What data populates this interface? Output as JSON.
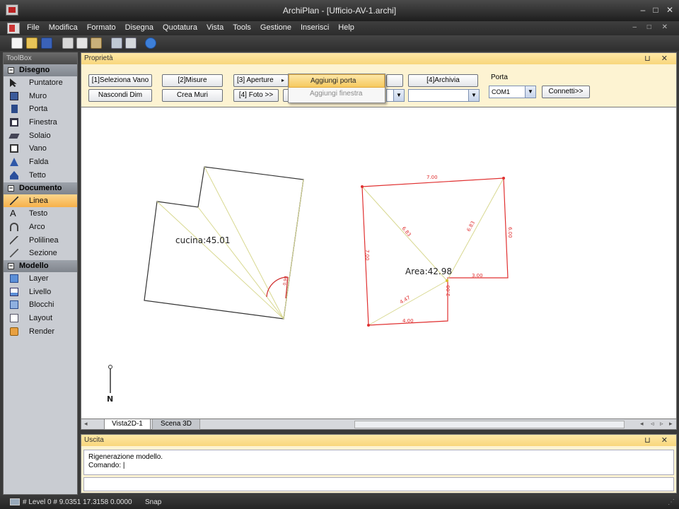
{
  "window": {
    "title": "ArchiPlan - [Ufficio-AV-1.archi]",
    "minimize": "–",
    "maximize": "□",
    "close": "✕"
  },
  "menu": {
    "items": [
      "File",
      "Modifica",
      "Formato",
      "Disegna",
      "Quotatura",
      "Vista",
      "Tools",
      "Gestione",
      "Inserisci",
      "Help"
    ],
    "mdi_controls": "– □ ✕"
  },
  "toolbox": {
    "title": "ToolBox",
    "sections": [
      {
        "label": "Disegno",
        "items": [
          {
            "label": "Puntatore",
            "icon": "pointer-icon"
          },
          {
            "label": "Muro",
            "icon": "wall-icon"
          },
          {
            "label": "Porta",
            "icon": "door-icon"
          },
          {
            "label": "Finestra",
            "icon": "window-icon"
          },
          {
            "label": "Solaio",
            "icon": "floor-slab-icon"
          },
          {
            "label": "Vano",
            "icon": "room-icon"
          },
          {
            "label": "Falda",
            "icon": "roof-pitch-icon"
          },
          {
            "label": "Tetto",
            "icon": "roof-icon"
          }
        ]
      },
      {
        "label": "Documento",
        "items": [
          {
            "label": "Linea",
            "icon": "line-icon",
            "selected": true
          },
          {
            "label": "Testo",
            "icon": "text-icon"
          },
          {
            "label": "Arco",
            "icon": "arc-icon"
          },
          {
            "label": "Polilinea",
            "icon": "polyline-icon"
          },
          {
            "label": "Sezione",
            "icon": "section-icon"
          }
        ]
      },
      {
        "label": "Modello",
        "items": [
          {
            "label": "Layer",
            "icon": "layer-icon"
          },
          {
            "label": "Livello",
            "icon": "level-icon"
          },
          {
            "label": "Blocchi",
            "icon": "blocks-icon"
          },
          {
            "label": "Layout",
            "icon": "layout-icon"
          },
          {
            "label": "Render",
            "icon": "render-icon"
          }
        ]
      }
    ]
  },
  "properties": {
    "title": "Proprietà",
    "panel_controls": "⊔ ✕",
    "buttons": {
      "select_room": "[1]Seleziona Vano",
      "hide_dims": "Nascondi Dim",
      "measures": "[2]Misure",
      "create_walls": "Crea Muri",
      "openings": "[3] Aperture",
      "photo": "[4] Foto >>",
      "archive": "[4]Archivia",
      "connect": "Connetti>>"
    },
    "port_label": "Porta",
    "port_value": "COM1",
    "openings_menu": [
      {
        "label": "Aggiungi porta",
        "highlighted": true
      },
      {
        "label": "Aggiungi finestra",
        "highlighted": false
      }
    ]
  },
  "drawing": {
    "room1_label": "cucina:45.01",
    "room2_label": "Area:42.98",
    "dims": {
      "top": "7.00",
      "right": "6.00",
      "left": "7.00",
      "bottom": "4.00",
      "step_h": "3.00",
      "step_v": "2.00",
      "diag1": "6.83",
      "diag2": "6.83",
      "diag3": "4.47",
      "door": "0.90"
    },
    "north_label": "N",
    "line_color_room2": "#e03030",
    "diag_color": "#d8d890"
  },
  "tabs": {
    "items": [
      {
        "label": "Vista2D-1",
        "active": true
      },
      {
        "label": "Scena 3D",
        "active": false
      }
    ]
  },
  "output": {
    "title": "Uscita",
    "panel_controls": "⊔ ✕",
    "lines": [
      "Rigenerazione modello.",
      "Comando:  |"
    ]
  },
  "status": {
    "coords": "# Level 0 # 9.0351 17.3158 0.0000",
    "snap": "Snap"
  }
}
